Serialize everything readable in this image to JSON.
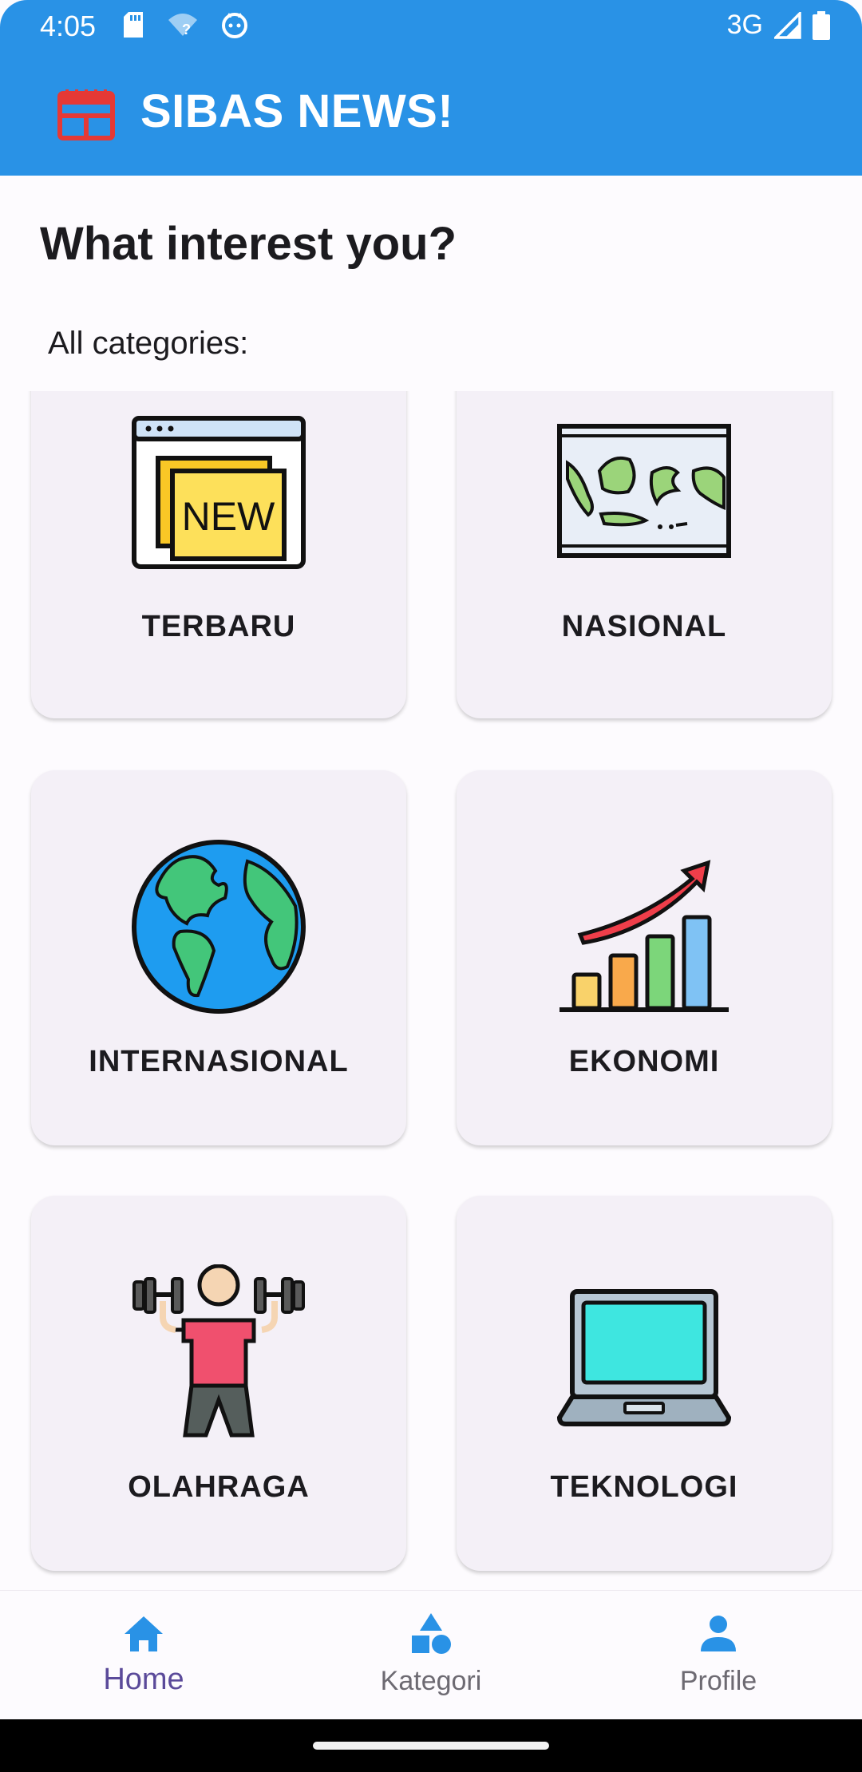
{
  "status_bar": {
    "time": "4:05",
    "network": "3G",
    "icons": [
      "sd-card-icon",
      "wifi-question-icon",
      "cat-icon",
      "signal-icon",
      "battery-icon"
    ]
  },
  "app_bar": {
    "title": "SIBAS NEWS!",
    "logo_icon": "newspaper-icon",
    "background": "#2992e6"
  },
  "heading": "What interest you?",
  "subheading": "All categories:",
  "categories": [
    {
      "label": "TERBARU",
      "icon": "new-badge-icon"
    },
    {
      "label": "NASIONAL",
      "icon": "indonesia-map-icon"
    },
    {
      "label": "INTERNASIONAL",
      "icon": "globe-icon"
    },
    {
      "label": "EKONOMI",
      "icon": "growth-chart-icon"
    },
    {
      "label": "OLAHRAGA",
      "icon": "weightlifter-icon"
    },
    {
      "label": "TEKNOLOGI",
      "icon": "laptop-icon"
    }
  ],
  "bottom_nav": {
    "items": [
      {
        "label": "Home",
        "icon": "home-icon",
        "active": true
      },
      {
        "label": "Kategori",
        "icon": "shapes-icon",
        "active": false
      },
      {
        "label": "Profile",
        "icon": "person-icon",
        "active": false
      }
    ]
  },
  "colors": {
    "accent": "#2992e6",
    "active_nav_label": "#5b4a9a",
    "card_background": "#f4f0f7"
  }
}
